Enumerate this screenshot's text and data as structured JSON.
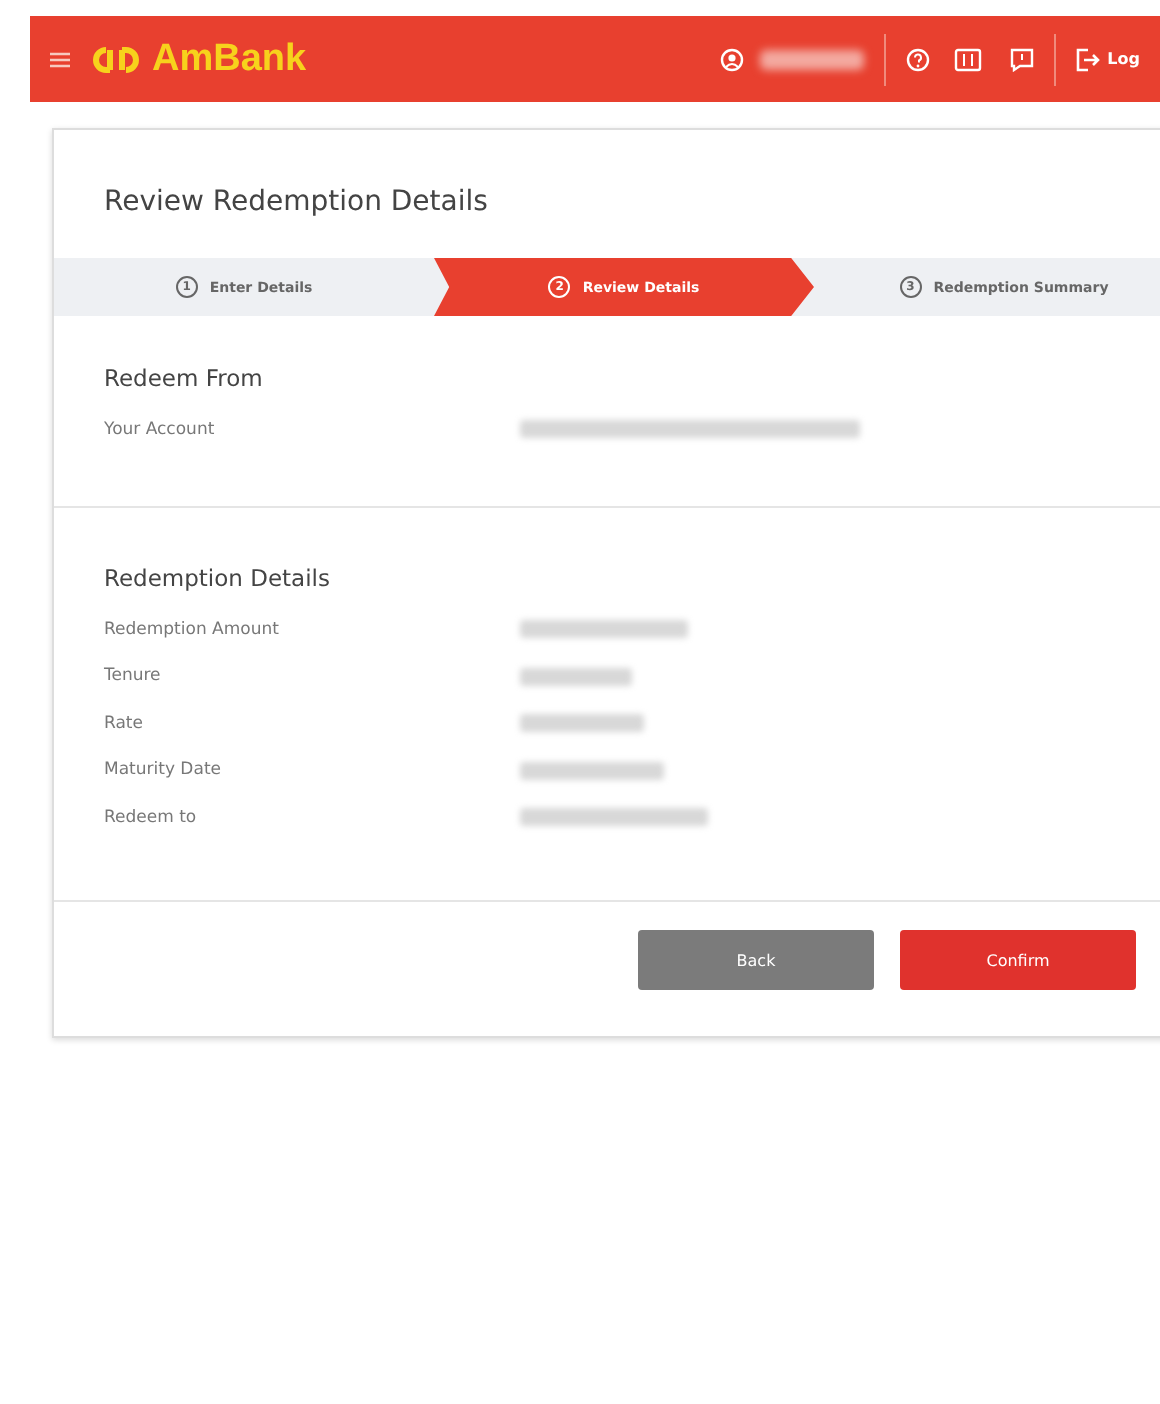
{
  "header": {
    "brand": "AmBank",
    "logout": "Log"
  },
  "card": {
    "title": "Review Redemption Details"
  },
  "steps": [
    {
      "number": "1",
      "label": "Enter Details",
      "selected": false
    },
    {
      "number": "2",
      "label": "Review Details",
      "selected": true
    },
    {
      "number": "3",
      "label": "Redemption Summary",
      "selected": false
    }
  ],
  "sections": [
    {
      "title": "Redeem From",
      "rows": [
        {
          "label": "Your Account"
        }
      ]
    },
    {
      "title": "Redemption Details",
      "rows": [
        {
          "label": "Redemption Amount"
        },
        {
          "label": "Tenure"
        },
        {
          "label": "Rate"
        },
        {
          "label": "Maturity Date"
        },
        {
          "label": "Redeem to"
        }
      ]
    }
  ],
  "buttons": [
    {
      "label": "Back",
      "kind": "secondary"
    },
    {
      "label": "Confirm",
      "kind": "primary"
    }
  ]
}
